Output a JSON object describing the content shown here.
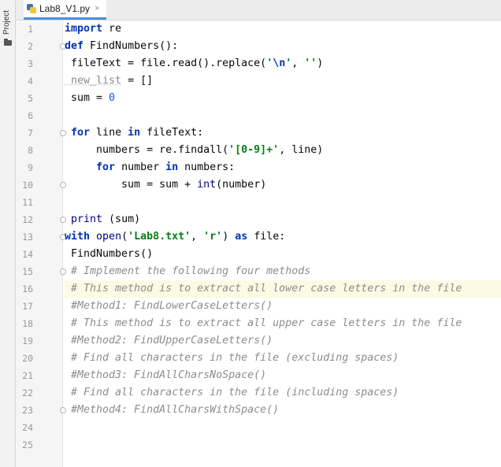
{
  "sidebar": {
    "project_label": "Project"
  },
  "tab": {
    "filename": "Lab8_V1.py",
    "close_glyph": "×"
  },
  "line_numbers": [
    "1",
    "2",
    "3",
    "4",
    "5",
    "6",
    "7",
    "8",
    "9",
    "10",
    "11",
    "12",
    "13",
    "14",
    "15",
    "16",
    "17",
    "18",
    "19",
    "20",
    "21",
    "22",
    "23",
    "24",
    "25"
  ],
  "code": {
    "l1": [
      "import",
      " re"
    ],
    "l2": [
      "def",
      " FindNumbers():"
    ],
    "l3": [
      " fileText = file.read().replace(",
      "'",
      "\\n",
      "'",
      ", ",
      "''",
      ")"
    ],
    "l4": [
      " new_list",
      " = []"
    ],
    "l5": [
      " sum = ",
      "0"
    ],
    "l7": [
      " ",
      "for",
      " line ",
      "in",
      " fileText:"
    ],
    "l8": [
      "     numbers = re.findall(",
      "'[0-9]+'",
      ", line)"
    ],
    "l9": [
      "     ",
      "for",
      " number ",
      "in",
      " numbers:"
    ],
    "l10": [
      "         sum = sum + ",
      "int",
      "(number)"
    ],
    "l12": [
      " ",
      "print",
      " (sum)"
    ],
    "l13": [
      "with",
      " ",
      "open",
      "(",
      "'Lab8.txt'",
      ", ",
      "'r'",
      ") ",
      "as",
      " file:"
    ],
    "l14": [
      " FindNumbers()"
    ],
    "l15": " # Implement the following four methods",
    "l16": " # This method is to extract all lower case letters in the file",
    "l17": " #Method1: FindLowerCaseLetters()",
    "l18": " # This method is to extract all upper case letters in the file",
    "l19": " #Method2: FindUpperCaseLetters()",
    "l20": " # Find all characters in the file (excluding spaces)",
    "l21": " #Method3: FindAllCharsNoSpace()",
    "l22": " # Find all characters in the file (including spaces)",
    "l23": " #Method4: FindAllCharsWithSpace()"
  },
  "colors": {
    "keyword": "#0033b3",
    "string": "#067d17",
    "number": "#1750eb",
    "comment": "#8c8c8c",
    "current_line": "#fcfae3"
  },
  "icons": [
    "folder-icon",
    "python-file-icon",
    "close-icon",
    "fold-marker-icon"
  ]
}
